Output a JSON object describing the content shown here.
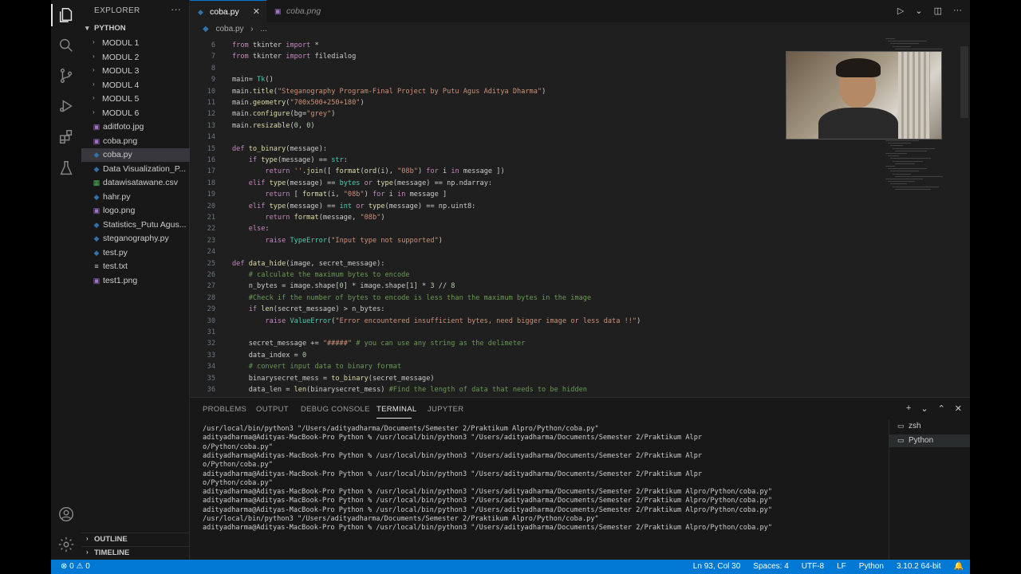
{
  "sidebar": {
    "title": "EXPLORER",
    "more": "···",
    "section": "PYTHON",
    "folders": [
      "MODUL 1",
      "MODUL 2",
      "MODUL 3",
      "MODUL 4",
      "MODUL 5",
      "MODUL 6"
    ],
    "files": [
      {
        "name": "aditfoto.jpg",
        "icon": "image-file-icon",
        "glyph": "▣",
        "color": "#a074c4"
      },
      {
        "name": "coba.png",
        "icon": "image-file-icon",
        "glyph": "▣",
        "color": "#a074c4"
      },
      {
        "name": "coba.py",
        "icon": "python-file-icon",
        "glyph": "◆",
        "color": "#3572a5",
        "selected": true
      },
      {
        "name": "Data Visualization_P...",
        "icon": "python-file-icon",
        "glyph": "◆",
        "color": "#3572a5"
      },
      {
        "name": "datawisatawane.csv",
        "icon": "csv-file-icon",
        "glyph": "▦",
        "color": "#4caf50"
      },
      {
        "name": "hahr.py",
        "icon": "python-file-icon",
        "glyph": "◆",
        "color": "#3572a5"
      },
      {
        "name": "logo.png",
        "icon": "image-file-icon",
        "glyph": "▣",
        "color": "#a074c4"
      },
      {
        "name": "Statistics_Putu Agus...",
        "icon": "python-file-icon",
        "glyph": "◆",
        "color": "#3572a5"
      },
      {
        "name": "steganography.py",
        "icon": "python-file-icon",
        "glyph": "◆",
        "color": "#3572a5"
      },
      {
        "name": "test.py",
        "icon": "python-file-icon",
        "glyph": "◆",
        "color": "#3572a5"
      },
      {
        "name": "test.txt",
        "icon": "text-file-icon",
        "glyph": "≡",
        "color": "#cccccc"
      },
      {
        "name": "test1.png",
        "icon": "image-file-icon",
        "glyph": "▣",
        "color": "#a074c4"
      }
    ],
    "outline": "OUTLINE",
    "timeline": "TIMELINE"
  },
  "tabs": [
    {
      "label": "coba.py",
      "close": "✕",
      "active": true
    },
    {
      "label": "coba.png",
      "active": false
    }
  ],
  "breadcrumb": {
    "file": "coba.py",
    "sep": "›",
    "rest": "..."
  },
  "code_lines": [
    {
      "n": "6",
      "t": "from tkinter import *"
    },
    {
      "n": "7",
      "t": "from tkinter import filedialog"
    },
    {
      "n": "8",
      "t": ""
    },
    {
      "n": "9",
      "t": "main= Tk()"
    },
    {
      "n": "10",
      "t": "main.title(\"Steganography Program-Final Project by Putu Agus Aditya Dharma\")"
    },
    {
      "n": "11",
      "t": "main.geometry(\"700x500+250+180\")"
    },
    {
      "n": "12",
      "t": "main.configure(bg=\"grey\")"
    },
    {
      "n": "13",
      "t": "main.resizable(0, 0)"
    },
    {
      "n": "14",
      "t": ""
    },
    {
      "n": "15",
      "t": "def to_binary(message):"
    },
    {
      "n": "16",
      "t": "    if type(message) == str:"
    },
    {
      "n": "17",
      "t": "        return ''.join([ format(ord(i), \"08b\") for i in message ])"
    },
    {
      "n": "18",
      "t": "    elif type(message) == bytes or type(message) == np.ndarray:"
    },
    {
      "n": "19",
      "t": "        return [ format(i, \"08b\") for i in message ]"
    },
    {
      "n": "20",
      "t": "    elif type(message) == int or type(message) == np.uint8:"
    },
    {
      "n": "21",
      "t": "        return format(message, \"08b\")"
    },
    {
      "n": "22",
      "t": "    else:"
    },
    {
      "n": "23",
      "t": "        raise TypeError(\"Input type not supported\")"
    },
    {
      "n": "24",
      "t": ""
    },
    {
      "n": "25",
      "t": "def data_hide(image, secret_message):"
    },
    {
      "n": "26",
      "t": "    # calculate the maximum bytes to encode"
    },
    {
      "n": "27",
      "t": "    n_bytes = image.shape[0] * image.shape[1] * 3 // 8"
    },
    {
      "n": "28",
      "t": "    #Check if the number of bytes to encode is less than the maximum bytes in the image"
    },
    {
      "n": "29",
      "t": "    if len(secret_message) > n_bytes:"
    },
    {
      "n": "30",
      "t": "        raise ValueError(\"Error encountered insufficient bytes, need bigger image or less data !!\")"
    },
    {
      "n": "31",
      "t": ""
    },
    {
      "n": "32",
      "t": "    secret_message += \"#####\" # you can use any string as the delimeter"
    },
    {
      "n": "33",
      "t": "    data_index = 0"
    },
    {
      "n": "34",
      "t": "    # convert input data to binary format"
    },
    {
      "n": "35",
      "t": "    binarysecret_mess = to_binary(secret_message)"
    },
    {
      "n": "36",
      "t": "    data_len = len(binarysecret_mess) #Find the length of data that needs to be hidden"
    }
  ],
  "panel": {
    "tabs": [
      "PROBLEMS",
      "OUTPUT",
      "DEBUG CONSOLE",
      "TERMINAL",
      "JUPYTER"
    ],
    "active_tab": "TERMINAL",
    "terminal_lines": [
      "/usr/local/bin/python3 \"/Users/adityadharma/Documents/Semester 2/Praktikum Alpro/Python/coba.py\"",
      "adityadharma@Adityas-MacBook-Pro Python % /usr/local/bin/python3 \"/Users/adityadharma/Documents/Semester 2/Praktikum Alpr",
      "o/Python/coba.py\"",
      "adityadharma@Adityas-MacBook-Pro Python % /usr/local/bin/python3 \"/Users/adityadharma/Documents/Semester 2/Praktikum Alpr",
      "o/Python/coba.py\"",
      "adityadharma@Adityas-MacBook-Pro Python % /usr/local/bin/python3 \"/Users/adityadharma/Documents/Semester 2/Praktikum Alpr",
      "o/Python/coba.py\"",
      "adityadharma@Adityas-MacBook-Pro Python % /usr/local/bin/python3 \"/Users/adityadharma/Documents/Semester 2/Praktikum Alpro/Python/coba.py\"",
      "adityadharma@Adityas-MacBook-Pro Python % /usr/local/bin/python3 \"/Users/adityadharma/Documents/Semester 2/Praktikum Alpro/Python/coba.py\"",
      "adityadharma@Adityas-MacBook-Pro Python % /usr/local/bin/python3 \"/Users/adityadharma/Documents/Semester 2/Praktikum Alpro/Python/coba.py\"",
      "/usr/local/bin/python3 \"/Users/adityadharma/Documents/Semester 2/Praktikum Alpro/Python/coba.py\"",
      "adityadharma@Adityas-MacBook-Pro Python % /usr/local/bin/python3 \"/Users/adityadharma/Documents/Semester 2/Praktikum Alpro/Python/coba.py\""
    ],
    "terminals": [
      {
        "name": "zsh",
        "selected": false
      },
      {
        "name": "Python",
        "selected": true
      }
    ]
  },
  "statusbar": {
    "left": "⊗ 0 ⚠ 0",
    "position": "Ln 93, Col 30",
    "spaces": "Spaces: 4",
    "encoding": "UTF-8",
    "eol": "LF",
    "language": "Python",
    "interpreter": "3.10.2 64-bit"
  },
  "colors": {
    "accent": "#0078d4",
    "background": "#1e1e1e"
  }
}
